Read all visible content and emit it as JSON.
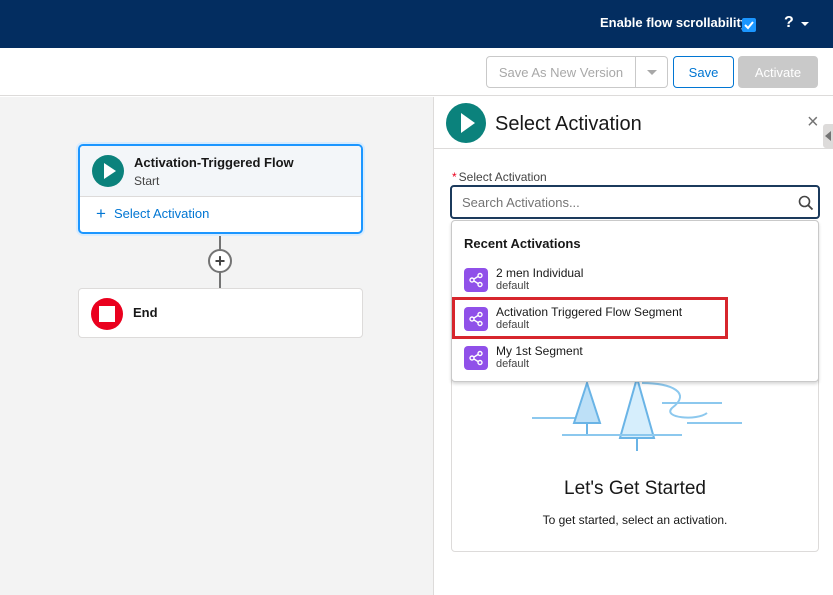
{
  "topbar": {
    "scrollability_label": "Enable flow scrollability",
    "scrollability_checked": true,
    "help_label": "?"
  },
  "toolbar": {
    "save_as_label": "Save As New Version",
    "save_label": "Save",
    "activate_label": "Activate"
  },
  "canvas": {
    "start_node": {
      "title": "Activation-Triggered Flow",
      "subtitle": "Start",
      "action_label": "Select Activation"
    },
    "add_symbol": "+",
    "end_node": {
      "title": "End"
    }
  },
  "panel": {
    "title": "Select Activation",
    "close_symbol": "×",
    "field_label": "Select Activation",
    "required_marker": "*",
    "search_placeholder": "Search Activations...",
    "dropdown": {
      "heading": "Recent Activations",
      "items": [
        {
          "name": "2 men Individual",
          "sub": "default"
        },
        {
          "name": "Activation Triggered Flow Segment",
          "sub": "default",
          "highlighted": true
        },
        {
          "name": "My 1st Segment",
          "sub": "default"
        }
      ]
    },
    "empty_state": {
      "title": "Let's Get Started",
      "subtitle": "To get started, select an activation."
    }
  },
  "colors": {
    "brand_navy": "#032d60",
    "accent_blue": "#0176d3",
    "start_teal": "#0b827c",
    "end_red": "#ea001e",
    "segment_purple": "#9050e9",
    "highlight_red": "#d7262d"
  },
  "icons": [
    "check-icon",
    "help-icon",
    "play-icon",
    "stop-icon",
    "plus-icon",
    "close-icon",
    "search-icon",
    "segment-icon"
  ]
}
